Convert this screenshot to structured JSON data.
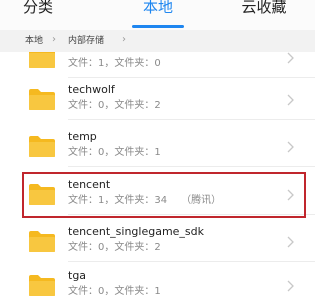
{
  "tabs": [
    {
      "label": "分类"
    },
    {
      "label": "本地"
    },
    {
      "label": "云收藏"
    }
  ],
  "active_tab": "本地",
  "breadcrumb": [
    "本地",
    "内部存储"
  ],
  "folders": [
    {
      "name": "",
      "meta": "文件：1，文件夹：0",
      "note": ""
    },
    {
      "name": "techwolf",
      "meta": "文件：0，文件夹：2",
      "note": ""
    },
    {
      "name": "temp",
      "meta": "文件：0，文件夹：1",
      "note": ""
    },
    {
      "name": "tencent",
      "meta": "文件：1，文件夹：34",
      "note": "（腾讯）"
    },
    {
      "name": "tencent_singlegame_sdk",
      "meta": "文件：0，文件夹：2",
      "note": ""
    },
    {
      "name": "tga",
      "meta": "文件：0，文件夹：1",
      "note": ""
    }
  ],
  "highlighted_folder": "tencent",
  "colors": {
    "accent": "#1e86f0",
    "folder": "#f5b920",
    "highlight_border": "#c0262d"
  }
}
